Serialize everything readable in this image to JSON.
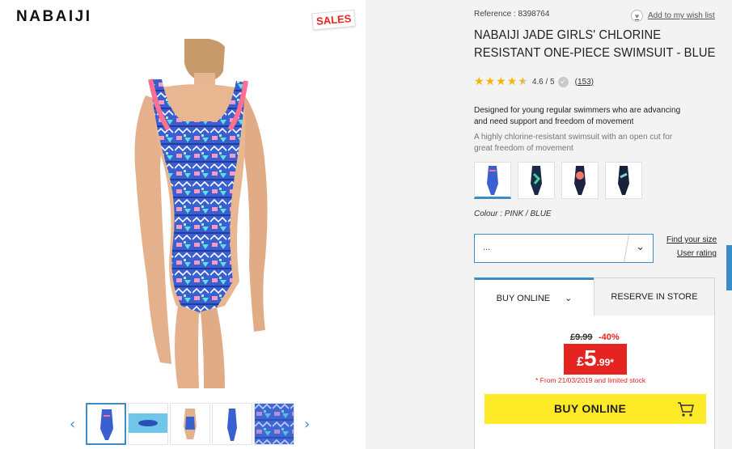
{
  "brand": {
    "name": "NABAIJI"
  },
  "badge": {
    "sales": "SALES"
  },
  "gallery": {
    "main_image": "girl-in-patterned-swimsuit",
    "prev_icon": "chevron-left-icon",
    "next_icon": "chevron-right-icon",
    "thumbnails": [
      "front-view",
      "swimming-photo",
      "back-view",
      "side-view",
      "fabric-detail"
    ]
  },
  "product": {
    "reference_label": "Reference : 8398764",
    "wishlist_label": "Add to my wish list",
    "title_line1": "NABAIJI JADE GIRLS' CHLORINE",
    "title_line2": "RESISTANT ONE-PIECE SWIMSUIT - BLUE",
    "rating_value": 4.6,
    "rating_text": "4.6 / 5",
    "reviews_count": "(153)",
    "description_main": "Designed for young regular swimmers who are advancing and need support and freedom of movement",
    "description_sub": "A highly chlorine-resistant swimsuit with an open cut for great freedom of movement",
    "colour_label": "Colour : PINK / BLUE",
    "swatches": [
      "pink-blue",
      "navy-green",
      "navy-coral",
      "navy-aqua"
    ]
  },
  "size": {
    "select_value": "...",
    "find_size_link": "Find your size",
    "user_rating_link": "User rating"
  },
  "tabs": {
    "buy_online": "BUY ONLINE",
    "reserve_in_store": "RESERVE IN STORE"
  },
  "pricing": {
    "old_price": "£9.99",
    "discount": "-40%",
    "currency": "£",
    "price_int": "5",
    "price_dec": ".99*",
    "note": "* From 21/03/2019 and limited stock"
  },
  "buy_button": {
    "label": "BUY ONLINE"
  },
  "colors": {
    "accent_blue": "#3c8dc7",
    "sale_red": "#e52321",
    "buy_yellow": "#ffea28",
    "star_gold": "#f5b400"
  }
}
